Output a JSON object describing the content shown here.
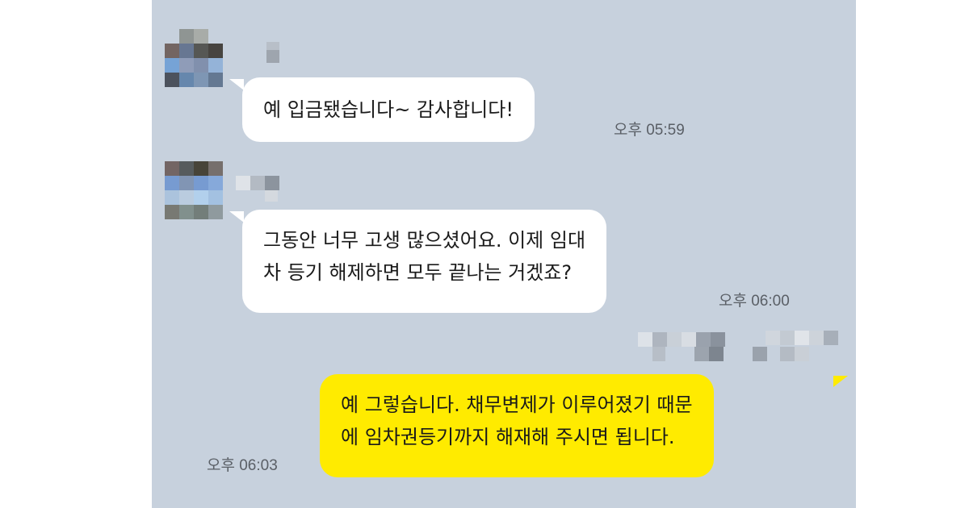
{
  "messages": [
    {
      "direction": "incoming",
      "lines": [
        "예 입금됐습니다~ 감사합니다!"
      ],
      "time": "오후 05:59"
    },
    {
      "direction": "incoming",
      "lines": [
        "그동안 너무 고생 많으셨어요. 이제 임대",
        "차 등기 해제하면 모두 끝나는 거겠죠?"
      ],
      "time": "오후 06:00"
    },
    {
      "direction": "outgoing",
      "lines": [
        "예 그렇습니다. 채무변제가 이루어졌기 때문",
        "에 임차권등기까지 해재해 주시면 됩니다."
      ],
      "time": "오후 06:03"
    }
  ],
  "colors": {
    "chat_background": "#c7d1dd",
    "incoming_bubble": "#ffffff",
    "outgoing_bubble": "#ffeb00",
    "timestamp": "#5a5f66"
  },
  "icons": {
    "avatar": "pixelated-avatar-icon",
    "name": "pixelated-name"
  }
}
